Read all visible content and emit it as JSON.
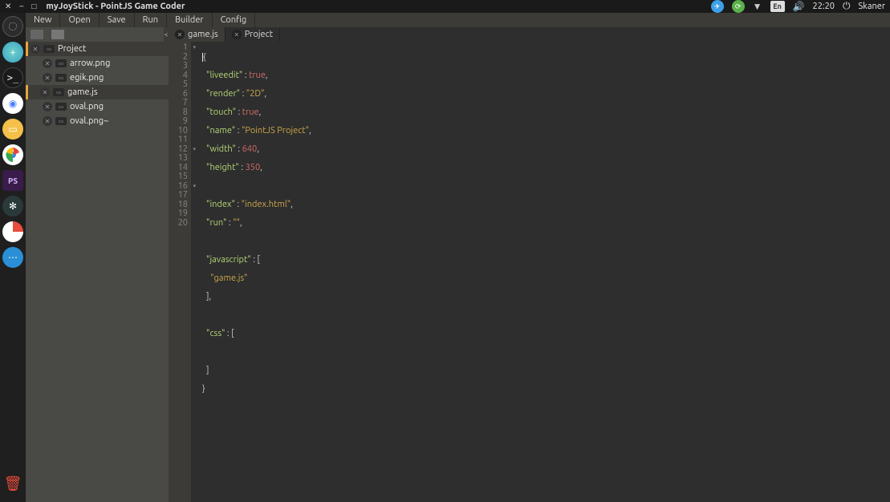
{
  "system": {
    "title": "myJoyStick - PointJS Game Coder",
    "lang": "En",
    "time": "22:20",
    "user": "Skaner"
  },
  "menu": {
    "new": "New",
    "open": "Open",
    "save": "Save",
    "run": "Run",
    "builder": "Builder",
    "config": "Config"
  },
  "tree": {
    "root": "Project",
    "items": [
      {
        "name": "arrow.png"
      },
      {
        "name": "egik.png"
      },
      {
        "name": "game.js"
      },
      {
        "name": "oval.png"
      },
      {
        "name": "oval.png~"
      }
    ]
  },
  "tabs": {
    "t0": "game.js",
    "t1": "Project"
  },
  "code": {
    "l1": "{",
    "l2a": "\"liveedit\"",
    "l2b": " : ",
    "l2c": "true",
    "l2d": ",",
    "l3a": "\"render\"",
    "l3b": " : ",
    "l3c": "\"2D\"",
    "l3d": ",",
    "l4a": "\"touch\"",
    "l4b": " : ",
    "l4c": "true",
    "l4d": ",",
    "l5a": "\"name\"",
    "l5b": " : ",
    "l5c": "\"PointJS Project\"",
    "l5d": ",",
    "l6a": "\"width\"",
    "l6b": " : ",
    "l6c": "640",
    "l6d": ",",
    "l7a": "\"height\"",
    "l7b": " : ",
    "l7c": "350",
    "l7d": ",",
    "l9a": "\"index\"",
    "l9b": " : ",
    "l9c": "\"index.html\"",
    "l9d": ",",
    "l10a": "\"run\"",
    "l10b": " : ",
    "l10c": "\"\"",
    "l10d": ",",
    "l12a": "\"javascript\"",
    "l12b": " : [",
    "l13a": "\"game.js\"",
    "l14": "],",
    "l16a": "\"css\"",
    "l16b": " : [",
    "l18": "]",
    "l19": "}"
  },
  "gutter": [
    "1",
    "2",
    "3",
    "4",
    "5",
    "6",
    "7",
    "8",
    "9",
    "10",
    "11",
    "12",
    "13",
    "14",
    "15",
    "16",
    "17",
    "18",
    "19",
    "20"
  ]
}
